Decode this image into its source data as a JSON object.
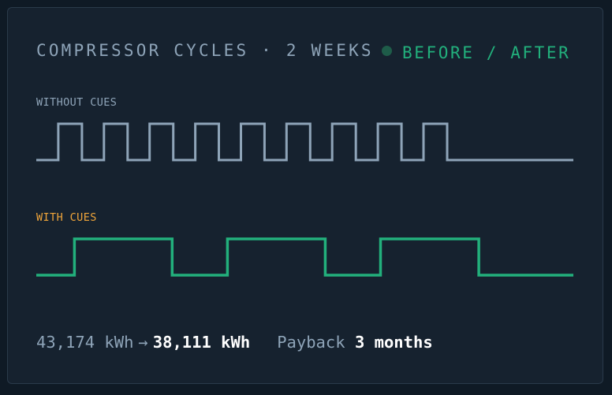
{
  "header": {
    "title": "COMPRESSOR CYCLES · 2 WEEKS",
    "status_label": "BEFORE / AFTER",
    "status_color": "#22b07c"
  },
  "chart_data": [
    {
      "type": "line",
      "series": [
        {
          "name": "WITHOUT CUES",
          "color": "#8ea4b8",
          "x": [
            0,
            0.041,
            0.041,
            0.085,
            0.085,
            0.126,
            0.126,
            0.17,
            0.17,
            0.211,
            0.211,
            0.255,
            0.255,
            0.296,
            0.296,
            0.34,
            0.34,
            0.381,
            0.381,
            0.425,
            0.425,
            0.466,
            0.466,
            0.51,
            0.51,
            0.551,
            0.551,
            0.595,
            0.595,
            0.636,
            0.636,
            0.68,
            0.68,
            0.721,
            0.721,
            0.765,
            0.765,
            0.806,
            0.806,
            1.0
          ],
          "values": [
            0,
            0,
            1,
            1,
            0,
            0,
            1,
            1,
            0,
            0,
            1,
            1,
            0,
            0,
            1,
            1,
            0,
            0,
            1,
            1,
            0,
            0,
            1,
            1,
            0,
            0,
            1,
            1,
            0,
            0,
            1,
            1,
            0,
            0,
            1,
            1,
            0,
            0,
            0,
            0
          ]
        }
      ]
    },
    {
      "type": "line",
      "series": [
        {
          "name": "WITH CUES",
          "color": "#22b07c",
          "x": [
            0,
            0.071,
            0.071,
            0.253,
            0.253,
            0.356,
            0.356,
            0.538,
            0.538,
            0.641,
            0.641,
            0.824,
            0.824,
            1.0
          ],
          "values": [
            0,
            0,
            1,
            1,
            0,
            0,
            1,
            1,
            0,
            0,
            1,
            1,
            0,
            0
          ]
        }
      ]
    }
  ],
  "footer": {
    "before_kwh": "43,174 kWh",
    "arrow": "→",
    "after_kwh": "38,111 kWh",
    "payback_label": "Payback",
    "payback_value": "3 months"
  }
}
